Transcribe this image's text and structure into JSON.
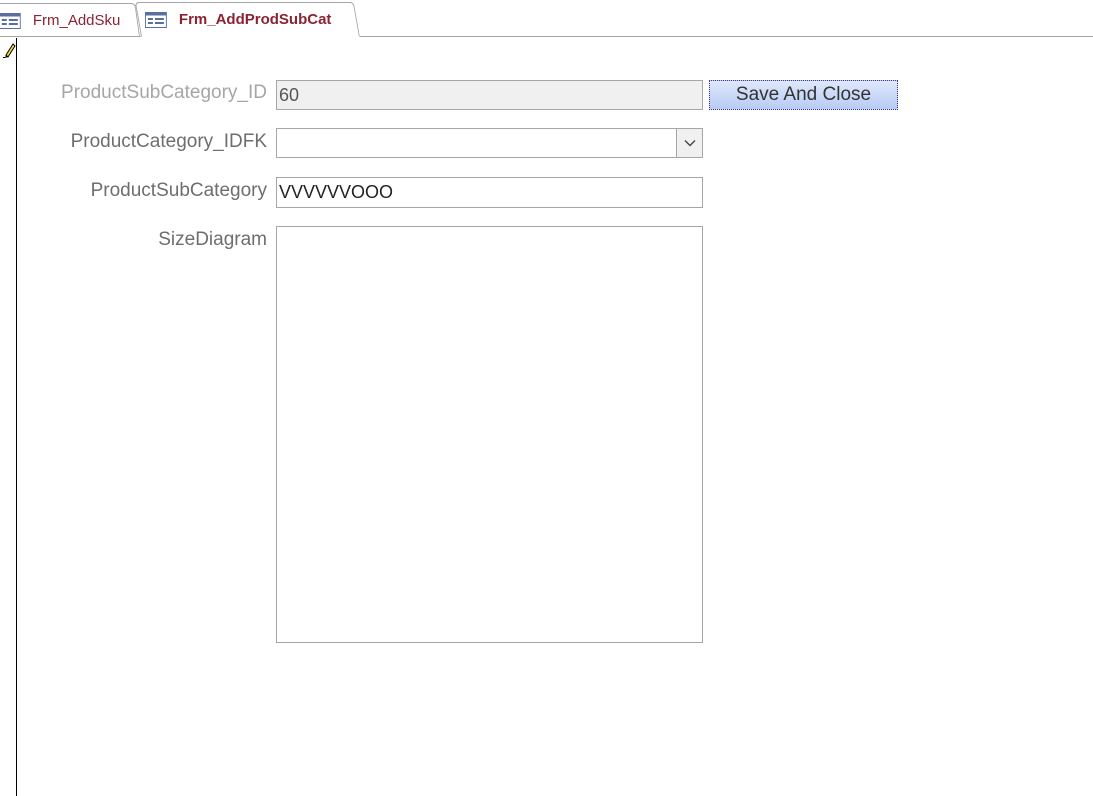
{
  "tabs": [
    {
      "label": "Frm_AddSku",
      "icon": "form-icon",
      "active": false
    },
    {
      "label": "Frm_AddProdSubCat",
      "icon": "form-icon",
      "active": true
    }
  ],
  "record_selector": {
    "icon": "pencil-edit-icon"
  },
  "form": {
    "subcategory_id": {
      "label": "ProductSubCategory_ID",
      "value": "60"
    },
    "category_idfk": {
      "label": "ProductCategory_IDFK",
      "value": "",
      "icon": "chevron-down-icon"
    },
    "subcategory": {
      "label": "ProductSubCategory",
      "value": "VVVVVVOOO"
    },
    "size_diagram": {
      "label": "SizeDiagram",
      "value": ""
    },
    "save_button": {
      "label": "Save And Close"
    }
  },
  "colors": {
    "tab_text": "#8b2332",
    "label_text": "#6e6e6e",
    "button_top": "#dfe8fb",
    "button_bottom": "#b8cbf4"
  }
}
